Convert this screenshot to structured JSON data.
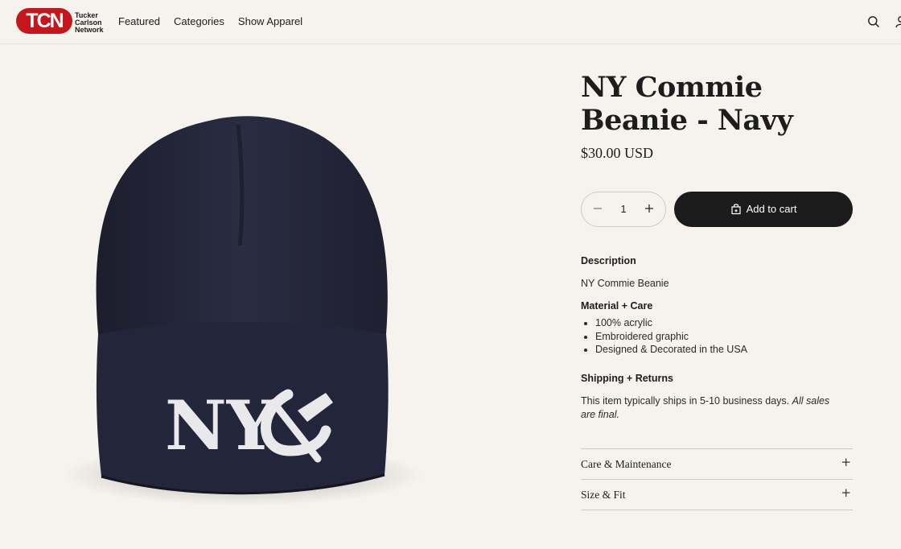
{
  "header": {
    "logo_text": "TCN",
    "logo_sub": [
      "Tucker",
      "Carlson",
      "Network"
    ],
    "nav": [
      "Featured",
      "Categories",
      "Show Apparel"
    ]
  },
  "product": {
    "title_lines": [
      "NY Commie",
      "Beanie - Navy"
    ],
    "price": "$30.00 USD",
    "quantity": "1",
    "add_to_cart": "Add to cart",
    "image_text": "NY"
  },
  "details": {
    "description_heading": "Description",
    "description_text": "NY Commie Beanie",
    "material_heading": "Material + Care",
    "material_items": [
      "100% acrylic",
      "Embroidered graphic",
      "Designed & Decorated in the USA"
    ],
    "shipping_heading": "Shipping + Returns",
    "shipping_text": "This item typically ships in 5-10 business days.",
    "shipping_text_italic": "All sales are final."
  },
  "accordions": [
    "Care & Maintenance",
    "Size & Fit"
  ],
  "icons": [
    "search-icon",
    "account-icon",
    "minus-icon",
    "plus-icon",
    "cart-icon"
  ],
  "colors": {
    "brand_red": "#c4161c",
    "beanie_navy": "#23253a",
    "button": "#1b1b1b",
    "background": "#f6f3ee"
  }
}
